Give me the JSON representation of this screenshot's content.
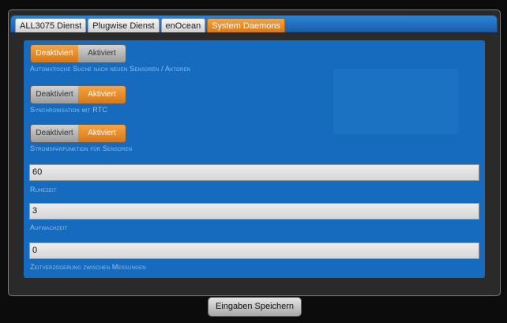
{
  "tabs": [
    {
      "label": "ALL3075 Dienst"
    },
    {
      "label": "Plugwise Dienst"
    },
    {
      "label": "enOcean"
    },
    {
      "label": "System Daemons"
    }
  ],
  "settings": {
    "auto_search": {
      "off_label": "Deaktiviert",
      "on_label": "Aktiviert",
      "value": "Deaktiviert",
      "label": "Automatische Suche nach neuen Sensoren / Aktoren"
    },
    "rtc_sync": {
      "off_label": "Deaktiviert",
      "on_label": "Aktiviert",
      "value": "Aktiviert",
      "label": "Synchronisation mit RTC"
    },
    "power_saving": {
      "off_label": "Deaktiviert",
      "on_label": "Aktiviert",
      "value": "Aktiviert",
      "label": "Stromsparfunktion für Sensoren"
    }
  },
  "fields": {
    "rest_time": {
      "value": "60",
      "label": "Ruhezeit"
    },
    "wake_time": {
      "value": "3",
      "label": "Aufwachzeit"
    },
    "measure_delay": {
      "value": "0",
      "label": "Zeitverzögerung zwischen Messungen"
    }
  },
  "actions": {
    "save_label": "Eingaben Speichern"
  },
  "colors": {
    "accent": "#e88b2c",
    "panel": "#166bbe",
    "background": "#0c0c0c"
  }
}
